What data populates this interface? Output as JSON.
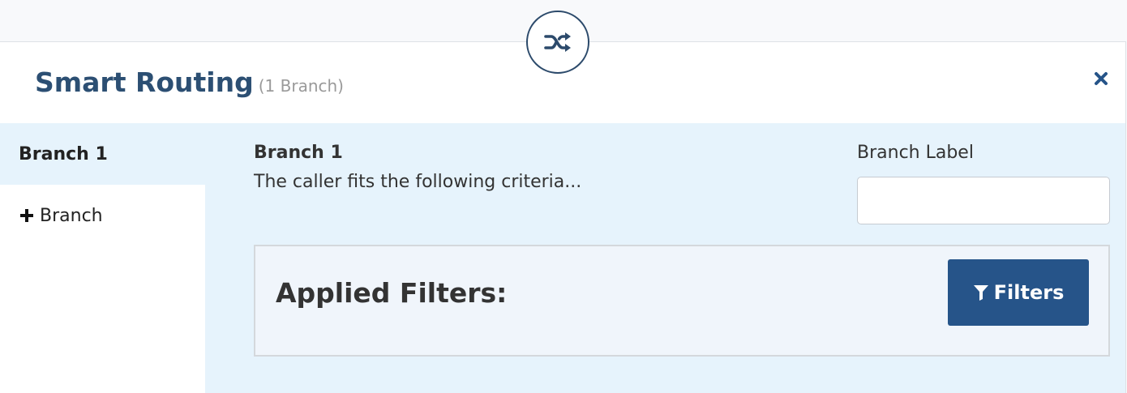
{
  "header": {
    "title": "Smart Routing",
    "count": "(1 Branch)",
    "shuffle_icon": "shuffle-icon",
    "close_icon": "close-icon"
  },
  "sidebar": {
    "items": [
      {
        "label": "Branch 1",
        "active": true
      },
      {
        "label": "Branch",
        "icon": "plus-icon"
      }
    ]
  },
  "branch": {
    "heading": "Branch 1",
    "description": "The caller fits the following criteria...",
    "label_caption": "Branch Label",
    "label_value": "",
    "label_placeholder": ""
  },
  "filters": {
    "title": "Applied Filters:",
    "button_label": "Filters",
    "button_icon": "funnel-icon"
  },
  "colors": {
    "title": "#2c4f73",
    "accent": "#265489",
    "body_bg": "#e6f3fc",
    "filters_bg": "#f0f5fb"
  }
}
